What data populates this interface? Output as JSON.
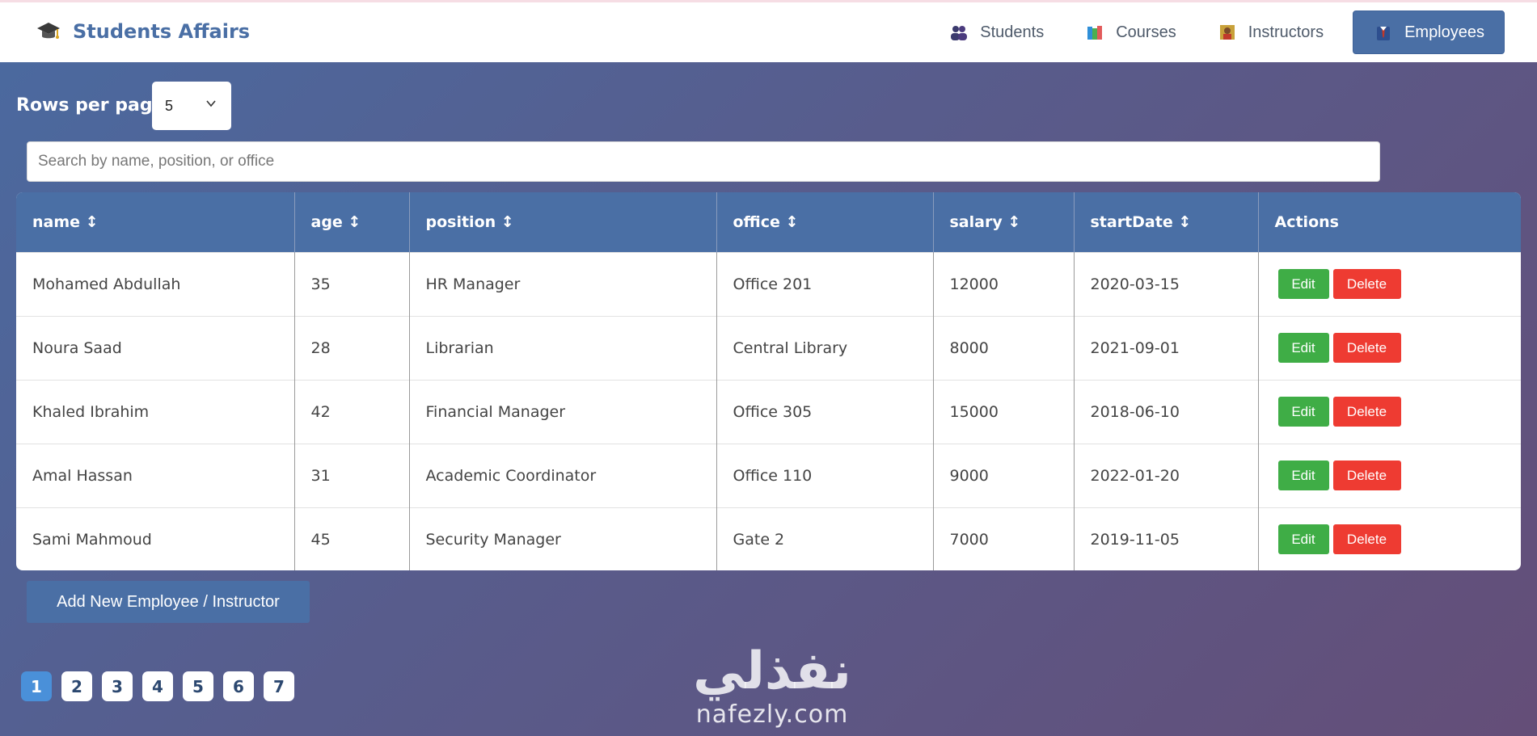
{
  "brand": {
    "title": "Students Affairs"
  },
  "nav": [
    {
      "label": "Students",
      "icon": "students-icon"
    },
    {
      "label": "Courses",
      "icon": "books-icon"
    },
    {
      "label": "Instructors",
      "icon": "instructor-icon"
    },
    {
      "label": "Employees",
      "icon": "employee-icon",
      "active": true
    }
  ],
  "rows_per_page": {
    "label": "Rows per page:",
    "value": "5"
  },
  "search": {
    "placeholder": "Search by name, position, or office",
    "value": ""
  },
  "table": {
    "columns": [
      "name ↕",
      "age ↕",
      "position ↕",
      "office ↕",
      "salary ↕",
      "startDate ↕",
      "Actions"
    ],
    "rows": [
      {
        "name": "Mohamed Abdullah",
        "age": "35",
        "position": "HR Manager",
        "office": "Office 201",
        "salary": "12000",
        "startDate": "2020-03-15"
      },
      {
        "name": "Noura Saad",
        "age": "28",
        "position": "Librarian",
        "office": "Central Library",
        "salary": "8000",
        "startDate": "2021-09-01"
      },
      {
        "name": "Khaled Ibrahim",
        "age": "42",
        "position": "Financial Manager",
        "office": "Office 305",
        "salary": "15000",
        "startDate": "2018-06-10"
      },
      {
        "name": "Amal Hassan",
        "age": "31",
        "position": "Academic Coordinator",
        "office": "Office 110",
        "salary": "9000",
        "startDate": "2022-01-20"
      },
      {
        "name": "Sami Mahmoud",
        "age": "45",
        "position": "Security Manager",
        "office": "Gate 2",
        "salary": "7000",
        "startDate": "2019-11-05"
      }
    ],
    "edit_label": "Edit",
    "delete_label": "Delete"
  },
  "add_button": {
    "label": "Add New Employee / Instructor"
  },
  "pagination": {
    "pages": [
      "1",
      "2",
      "3",
      "4",
      "5",
      "6",
      "7"
    ],
    "active": "1"
  },
  "watermark": {
    "arabic": "نفذلي",
    "latin": "nafezly.com"
  },
  "colors": {
    "primary": "#4a6fa5",
    "edit": "#3fad46",
    "delete": "#ee3b32",
    "active_page": "#4a90d9"
  }
}
